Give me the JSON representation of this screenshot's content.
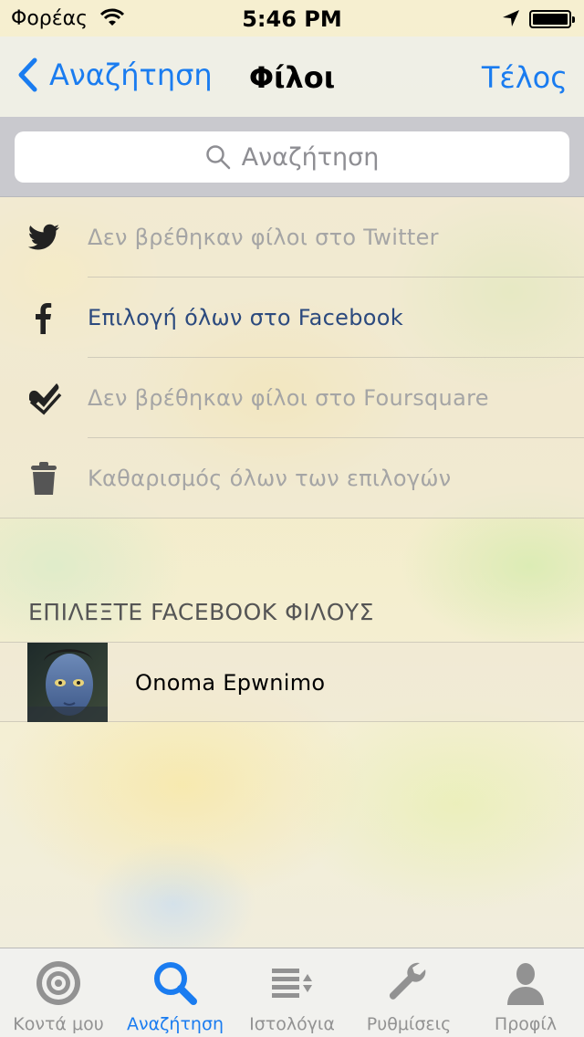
{
  "status_bar": {
    "carrier": "Φορέας",
    "time": "5:46 PM",
    "wifi_icon": "wifi-icon",
    "location_icon": "location-arrow-icon",
    "battery_level": 1.0
  },
  "nav": {
    "back_label": "Αναζήτηση",
    "title": "Φίλοι",
    "done_label": "Τέλος"
  },
  "search": {
    "placeholder": "Αναζήτηση"
  },
  "actions": [
    {
      "icon": "twitter-icon",
      "label": "Δεν βρέθηκαν φίλοι στο Twitter",
      "enabled": false
    },
    {
      "icon": "facebook-icon",
      "label": "Επιλογή όλων στο Facebook",
      "enabled": true
    },
    {
      "icon": "foursquare-icon",
      "label": "Δεν βρέθηκαν φίλοι στο Foursquare",
      "enabled": false
    },
    {
      "icon": "trash-icon",
      "label": "Καθαρισμός όλων των επιλογών",
      "enabled": false
    }
  ],
  "section": {
    "header": "ΕΠΙΛΕΞΤΕ FACEBOOK ΦΙΛΟΥΣ"
  },
  "friends": [
    {
      "name": "Onoma Epwnimo",
      "avatar": "avatar-image"
    }
  ],
  "tabs": [
    {
      "label": "Κοντά μου",
      "icon": "target-icon",
      "selected": false
    },
    {
      "label": "Αναζήτηση",
      "icon": "search-icon",
      "selected": true
    },
    {
      "label": "Ιστολόγια",
      "icon": "list-sort-icon",
      "selected": false
    },
    {
      "label": "Ρυθμίσεις",
      "icon": "wrench-icon",
      "selected": false
    },
    {
      "label": "Προφίλ",
      "icon": "person-icon",
      "selected": false
    }
  ],
  "colors": {
    "accent": "#1a7cf0",
    "disabled_text": "#a5a5a5",
    "facebook_text": "#2c4a7e",
    "tab_inactive": "#929292"
  }
}
